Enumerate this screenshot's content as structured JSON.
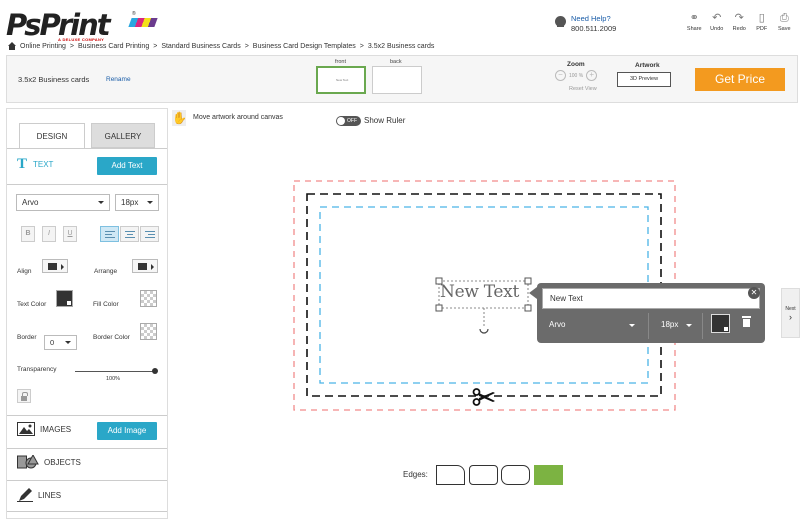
{
  "brand": {
    "logo_text": "PsPrint",
    "tagline": "A DELUXE COMPANY",
    "stripe_colors": [
      "#2aa7e0",
      "#d9267f",
      "#f4e11a",
      "#6b3b8e"
    ]
  },
  "help": {
    "label": "Need Help?",
    "phone": "800.511.2009"
  },
  "toolbar": {
    "share": "Share",
    "undo": "Undo",
    "redo": "Redo",
    "pdf": "PDF",
    "save": "Save"
  },
  "breadcrumb": {
    "items": [
      "Online Printing",
      "Business Card Printing",
      "Standard Business Cards",
      "Business Card Design Templates",
      "3.5x2 Business cards"
    ]
  },
  "product": {
    "name": "3.5x2 Business cards",
    "rename": "Rename"
  },
  "sides": {
    "front": "front",
    "back": "back",
    "front_preview_text": "New Text"
  },
  "zoom": {
    "label": "Zoom",
    "value": "100 %",
    "reset": "Reset View"
  },
  "artwork": {
    "label": "Artwork",
    "preview": "3D Preview"
  },
  "cta": {
    "get_price": "Get Price",
    "color": "#f39a1f"
  },
  "panel": {
    "tabs": [
      "DESIGN",
      "GALLERY"
    ],
    "text_icon": "T",
    "text_section": "TEXT",
    "add_text": "Add Text",
    "font": "Arvo",
    "size": "18px",
    "bold": "B",
    "italic": "I",
    "underline": "U",
    "align_label": "Align",
    "arrange_label": "Arrange",
    "text_color_label": "Text Color",
    "fill_color_label": "Fill Color",
    "border_label": "Border",
    "border_value": "0",
    "border_color_label": "Border Color",
    "transparency_label": "Transparency",
    "transparency_value": "100%",
    "images": "IMAGES",
    "add_image": "Add Image",
    "objects": "OBJECTS",
    "lines": "LINES",
    "accent_color": "#2aa7c8"
  },
  "canvas": {
    "move_hint": "Move artwork around canvas",
    "toggle_state": "OFF",
    "show_ruler": "Show Ruler",
    "text_object": "New Text",
    "bleed_color": "#f28b8b",
    "trim_color": "#111111",
    "safe_color": "#4ab3e6"
  },
  "popover": {
    "input_value": "New Text",
    "font": "Arvo",
    "size": "18px"
  },
  "nav": {
    "next": "Next"
  },
  "edges": {
    "label": "Edges:",
    "selected_color": "#7cb342"
  }
}
